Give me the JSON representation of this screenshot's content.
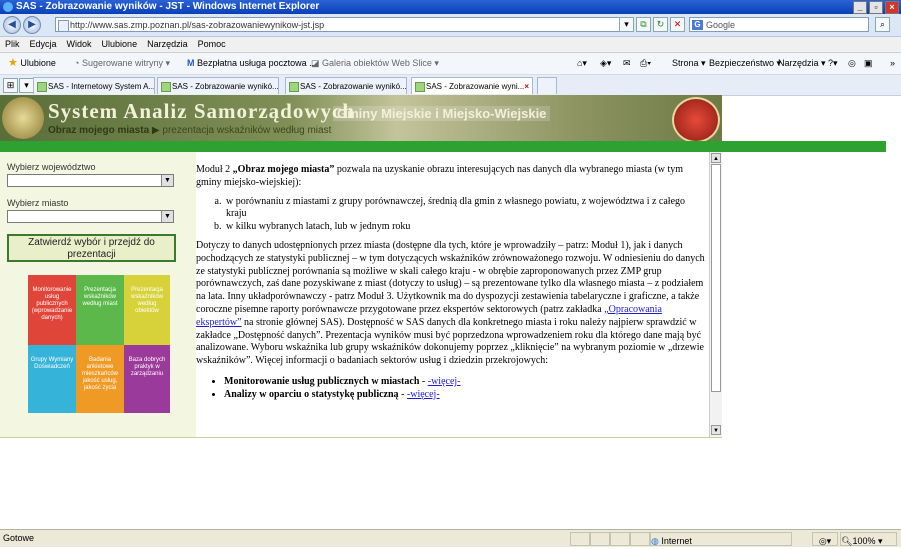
{
  "window": {
    "title": "SAS - Zobrazowanie wyników - JST - Windows Internet Explorer",
    "min": "_",
    "max": "▫",
    "close": "×"
  },
  "address": {
    "url": "http://www.sas.zmp.poznan.pl/sas-zobrazowaniewynikow-jst.jsp",
    "search_placeholder": "Google",
    "back": "◀",
    "forward": "▶"
  },
  "menu": [
    "Plik",
    "Edycja",
    "Widok",
    "Ulubione",
    "Narzędzia",
    "Pomoc"
  ],
  "favorites": {
    "label": "Ulubione",
    "items": [
      "Sugerowane witryny ▾",
      "Bezpłatna usługa pocztowa ...",
      "Galeria obiektów Web Slice ▾"
    ],
    "right": [
      "Strona ▾",
      "Bezpieczeństwo ▾",
      "Narzędzia ▾"
    ]
  },
  "tabs": [
    {
      "label": "SAS - Internetowy System A..."
    },
    {
      "label": "SAS - Zobrazowanie wynikó..."
    },
    {
      "label": "SAS - Zobrazowanie wynikó..."
    },
    {
      "label": "SAS - Zobrazowanie wyni..."
    }
  ],
  "banner": {
    "title": "System Analiz Samorządowych",
    "subtitle": "Gminy Miejskie i Miejsko-Wiejskie",
    "crumb_main": "Obraz mojego miasta",
    "crumb_arrow": "▶",
    "crumb_sub": "prezentacja wskaźników według miast"
  },
  "sidebar": {
    "voivodeship_label": "Wybierz województwo",
    "city_label": "Wybierz miasto",
    "submit_label": "Zatwierdź wybór i przejdź do prezentacji",
    "puzzle": [
      {
        "text": "Monitorowanie usług publicznych (wprowadzanie danych)",
        "color": "#e0453a"
      },
      {
        "text": "Prezentacja wskaźników według miast",
        "color": "#5cb84a"
      },
      {
        "text": "Prezentacja wskaźników według obiektów",
        "color": "#d7d23a"
      },
      {
        "text": "Grupy Wymiany Doświadczeń",
        "color": "#36b3d9"
      },
      {
        "text": "Badania ankietowe mieszkańców jakość usług, jakość życia",
        "color": "#f09a26"
      },
      {
        "text": "Baza dobrych praktyk w zarządzaniu",
        "color": "#9a3a9a"
      }
    ]
  },
  "content": {
    "intro_pre": "Moduł 2 ",
    "intro_bold": "„Obraz mojego miasta”",
    "intro_post": " pozwala na uzyskanie obrazu interesujących nas danych dla wybranego miasta (w tym gminy miejsko-wiejskiej):",
    "list": [
      "w porównaniu z miastami z grupy porównawczej, średnią dla gmin z własnego powiatu, z województwa i z całego kraju",
      "w kilku wybranych latach, lub w jednym roku"
    ],
    "para_pre": "Dotyczy to danych udostępnionych przez miasta (dostępne dla tych, które je wprowadziły – patrz: Moduł 1), jak i danych pochodzących ze statystyki publicznej – w tym dotyczących wskaźników zrównoważonego rozwoju. W odniesieniu do danych ze statystyki publicznej porównania są możliwe w skali całego kraju - w obrębie zaproponowanych przez ZMP grup porównawczych, zaś dane pozyskiwane z miast (dotyczy to usług) – są prezentowane tylko dla własnego miasta – z podziałem na lata. Inny układporównawczy - patrz Moduł 3. Użytkownik ma do dyspozycji zestawienia tabelaryczne i graficzne, a także coroczne pisemne raporty porównawcze przygotowane przez ekspertów sektorowych (patrz zakładka ",
    "para_link": "„Opracowania ekspertów”",
    "para_post": " na stronie głównej SAS). Dostępność w SAS danych dla konkretnego miasta i roku należy najpierw sprawdzić w zakładce „Dostępność danych”. Prezentacja wyników musi być poprzedzona wprowadzeniem roku dla którego dane mają być analizowane. Wyboru wskaźnika lub grupy wskaźników dokonujemy poprzez „kliknięcie” na wybranym poziomie w „drzewie wskaźników”. Więcej informacji o badaniach sektorów usług i dziedzin przekrojowych:",
    "bullets": [
      {
        "bold": "Monitorowanie usług publicznych w miastach",
        "sep": " - ",
        "link": "-więcej-"
      },
      {
        "bold": "Analizy w oparciu o statystykę publiczną",
        "sep": " - ",
        "link": "-więcej-"
      }
    ]
  },
  "status": {
    "text": "Gotowe",
    "zone": "Internet",
    "zoom": "100%"
  }
}
